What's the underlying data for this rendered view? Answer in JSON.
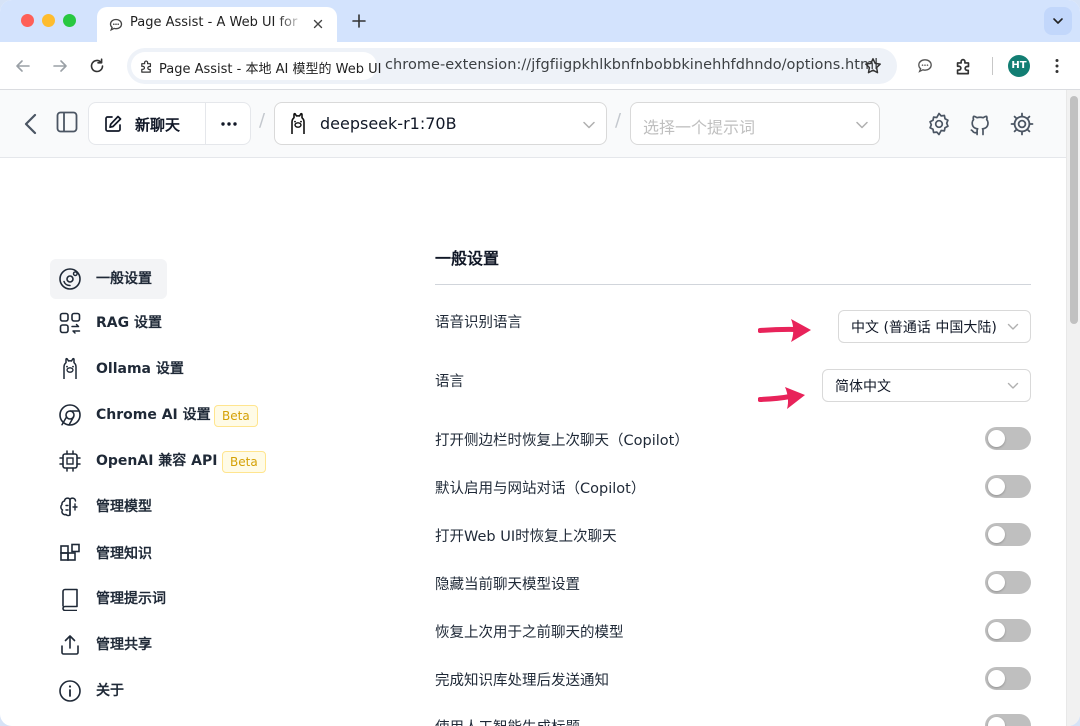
{
  "browser": {
    "tab_title": "Page Assist - A Web UI for Lo",
    "site_chip": "Page Assist - 本地 AI 模型的 Web UI",
    "url": "chrome-extension://jfgfiigpkhlkbnfnbobbkinehhfdhndo/options.html",
    "profile_initials": "HT",
    "profile_color": "#127e73"
  },
  "header": {
    "new_chat": "新聊天",
    "model": "deepseek-r1:70B",
    "prompt_placeholder": "选择一个提示词",
    "separator": "/"
  },
  "sidebar": {
    "items": [
      {
        "label": "一般设置",
        "icon": "settings-circle-icon",
        "active": true
      },
      {
        "label": "RAG 设置",
        "icon": "rag-icon"
      },
      {
        "label": "Ollama 设置",
        "icon": "ollama-icon"
      },
      {
        "label": "Chrome AI 设置",
        "icon": "chrome-icon",
        "badge": "Beta"
      },
      {
        "label": "OpenAI 兼容 API",
        "icon": "cpu-icon",
        "badge": "Beta"
      },
      {
        "label": "管理模型",
        "icon": "brain-icon"
      },
      {
        "label": "管理知识",
        "icon": "blocks-icon"
      },
      {
        "label": "管理提示词",
        "icon": "book-icon"
      },
      {
        "label": "管理共享",
        "icon": "share-icon"
      },
      {
        "label": "关于",
        "icon": "info-icon"
      }
    ]
  },
  "settings": {
    "title": "一般设置",
    "speech_lang_label": "语音识别语言",
    "speech_lang_value": "中文 (普通话 中国大陆)",
    "ui_lang_label": "语言",
    "ui_lang_value": "简体中文",
    "toggles": [
      {
        "label": "打开侧边栏时恢复上次聊天（Copilot）",
        "on": false
      },
      {
        "label": "默认启用与网站对话（Copilot）",
        "on": false
      },
      {
        "label": "打开Web UI时恢复上次聊天",
        "on": false
      },
      {
        "label": "隐藏当前聊天模型设置",
        "on": false
      },
      {
        "label": "恢复上次用于之前聊天的模型",
        "on": false
      },
      {
        "label": "完成知识库处理后发送通知",
        "on": false
      },
      {
        "label": "使用人工智能生成标题",
        "on": false
      }
    ]
  },
  "colors": {
    "annotation_arrow": "#e8235a",
    "toggle_off": "#bfbfbf",
    "beta_text": "#d4a106"
  }
}
